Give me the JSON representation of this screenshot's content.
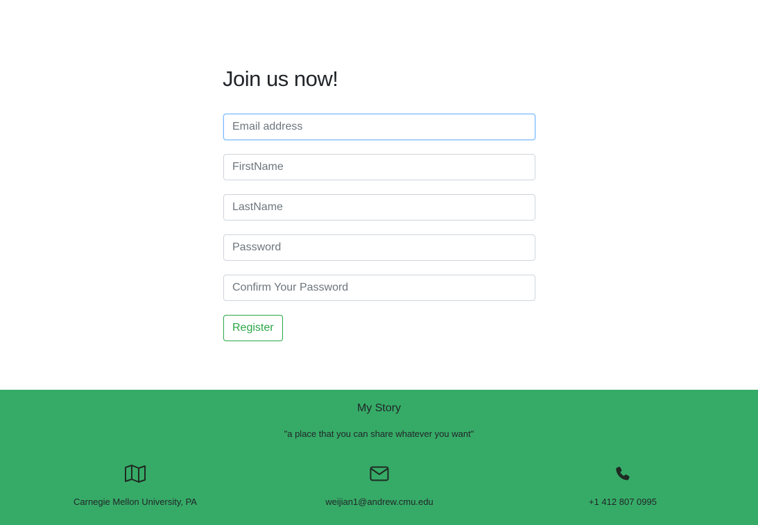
{
  "form": {
    "title": "Join us now!",
    "fields": {
      "email_placeholder": "Email address",
      "firstname_placeholder": "FirstName",
      "lastname_placeholder": "LastName",
      "password_placeholder": "Password",
      "confirm_placeholder": "Confirm Your Password"
    },
    "register_label": "Register"
  },
  "footer": {
    "title": "My Story",
    "tagline": "\"a place that you can share whatever you want\"",
    "contacts": [
      {
        "icon": "map-icon",
        "text": "Carnegie Mellon University, PA"
      },
      {
        "icon": "envelope-icon",
        "text": "weijian1@andrew.cmu.edu"
      },
      {
        "icon": "phone-icon",
        "text": "+1 412 807 0995"
      }
    ]
  },
  "colors": {
    "footer_bg": "#36ab67",
    "accent_green": "#28a745",
    "focus_border": "#80bdff"
  }
}
